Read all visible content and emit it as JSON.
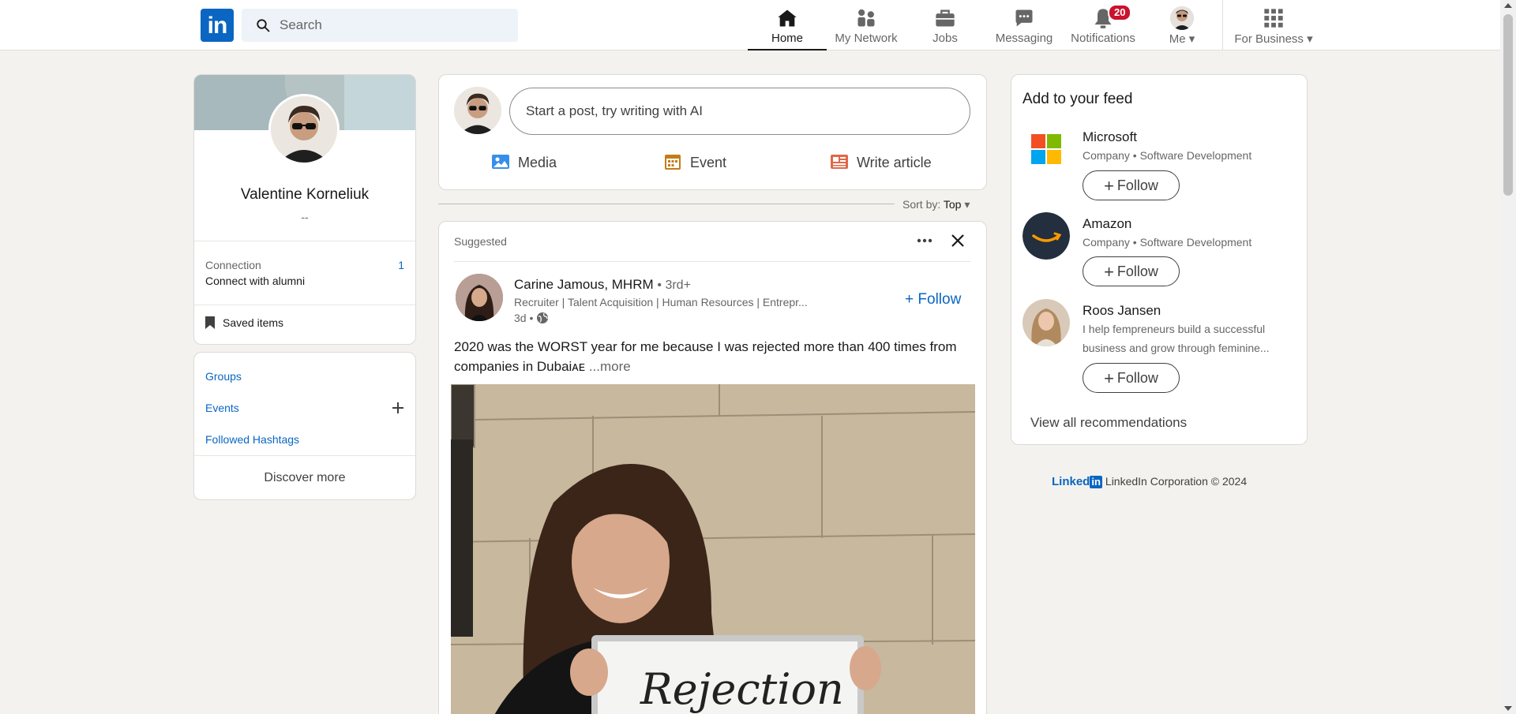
{
  "nav": {
    "logo_text": "in",
    "search_placeholder": "Search",
    "items": [
      {
        "label": "Home",
        "icon": "home-icon",
        "active": true
      },
      {
        "label": "My Network",
        "icon": "network-icon"
      },
      {
        "label": "Jobs",
        "icon": "briefcase-icon"
      },
      {
        "label": "Messaging",
        "icon": "chat-icon"
      },
      {
        "label": "Notifications",
        "icon": "bell-icon",
        "badge": "20"
      },
      {
        "label": "Me",
        "icon": "avatar"
      },
      {
        "label": "For Business",
        "icon": "grid-icon"
      }
    ]
  },
  "profile": {
    "name": "Valentine Korneliuk",
    "headline": "--",
    "connection_label": "Connection",
    "connection_sub": "Connect with alumni",
    "connection_count": "1",
    "saved_items": "Saved items"
  },
  "community": {
    "groups": "Groups",
    "events": "Events",
    "hashtags": "Followed Hashtags",
    "discover": "Discover more"
  },
  "composer": {
    "placeholder": "Start a post, try writing with AI",
    "media": "Media",
    "event": "Event",
    "article": "Write article"
  },
  "sort": {
    "label": "Sort by:",
    "value": "Top"
  },
  "post": {
    "suggested": "Suggested",
    "author": "Carine Jamous, MHRM",
    "degree": "• 3rd+",
    "headline": "Recruiter | Talent Acquisition | Human Resources | Entrepr...",
    "time": "3d •",
    "follow": "Follow",
    "text": "2020 was the WORST year for me because I was rejected more than 400 times from companies in Dubaiᴀᴇ",
    "more": "...more",
    "board_text": "Rejection"
  },
  "feed": {
    "title": "Add to your feed",
    "recommendations": [
      {
        "name": "Microsoft",
        "sub": "Company • Software Development",
        "follow": "Follow"
      },
      {
        "name": "Amazon",
        "sub": "Company • Software Development",
        "follow": "Follow"
      },
      {
        "name": "Roos Jansen",
        "sub": "I help fempreneurs build a successful business and grow through feminine...",
        "follow": "Follow"
      }
    ],
    "view_all": "View all recommendations"
  },
  "footer": {
    "brand_text": "Linked",
    "brand_box": "in",
    "copyright": "LinkedIn Corporation © 2024"
  },
  "colors": {
    "brand": "#0a66c2",
    "badge": "#cb112d",
    "background": "#f4f2ee"
  }
}
